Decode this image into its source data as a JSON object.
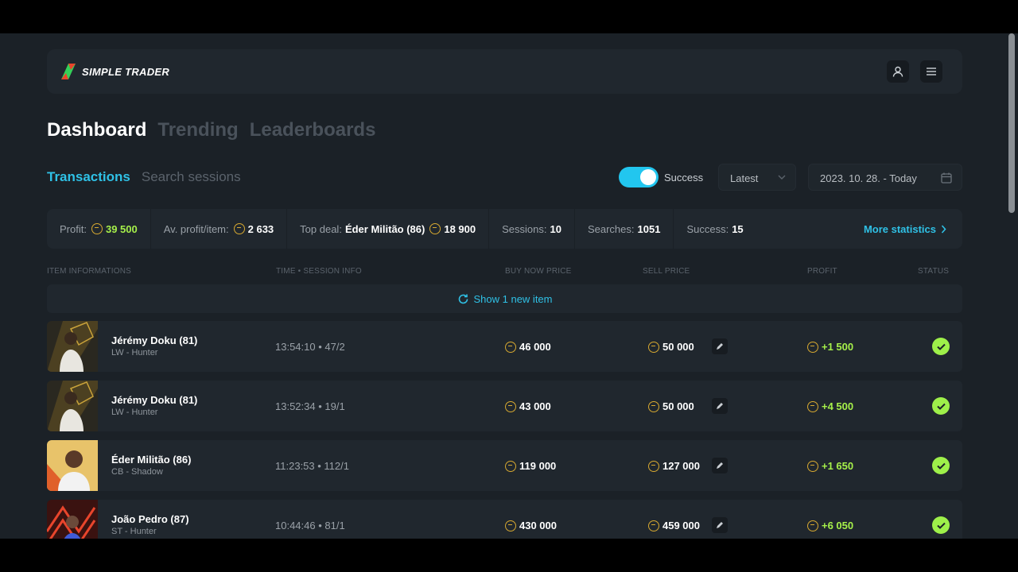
{
  "brand": {
    "name": "SIMPLE TRADER"
  },
  "nav": {
    "tabs": [
      {
        "label": "Dashboard"
      },
      {
        "label": "Trending"
      },
      {
        "label": "Leaderboards"
      }
    ]
  },
  "subnav": {
    "tabs": [
      {
        "label": "Transactions"
      },
      {
        "label": "Search sessions"
      }
    ]
  },
  "filters": {
    "toggle_label": "Success",
    "toggle_on": true,
    "sort_value": "Latest",
    "date_range": "2023. 10. 28. - Today"
  },
  "stats": {
    "profit_label": "Profit:",
    "profit_value": "39 500",
    "avg_label": "Av. profit/item:",
    "avg_value": "2 633",
    "top_label": "Top deal:",
    "top_name": "Éder Militão (86)",
    "top_value": "18 900",
    "sessions_label": "Sessions:",
    "sessions_value": "10",
    "searches_label": "Searches:",
    "searches_value": "1051",
    "success_label": "Success:",
    "success_value": "15",
    "more_label": "More statistics"
  },
  "table": {
    "headers": {
      "item": "ITEM INFORMATIONS",
      "time": "TIME • SESSION INFO",
      "buy": "BUY NOW PRICE",
      "sell": "SELL PRICE",
      "profit": "PROFIT",
      "status": "STATUS"
    },
    "new_items_label": "Show 1 new item",
    "rows": [
      {
        "name": "Jérémy Doku (81)",
        "sub": "LW - Hunter",
        "time": "13:54:10 • 47/2",
        "buy": "46 000",
        "sell": "50 000",
        "profit": "+1 500"
      },
      {
        "name": "Jérémy Doku (81)",
        "sub": "LW - Hunter",
        "time": "13:52:34 • 19/1",
        "buy": "43 000",
        "sell": "50 000",
        "profit": "+4 500"
      },
      {
        "name": "Éder Militão (86)",
        "sub": "CB - Shadow",
        "time": "11:23:53 • 112/1",
        "buy": "119 000",
        "sell": "127 000",
        "profit": "+1 650"
      },
      {
        "name": "João Pedro (87)",
        "sub": "ST - Hunter",
        "time": "10:44:46 • 81/1",
        "buy": "430 000",
        "sell": "459 000",
        "profit": "+6 050"
      }
    ]
  },
  "colors": {
    "accent": "#2fc1e6",
    "profit": "#a6f04a",
    "coin": "#d7a930",
    "status_ok": "#9ef04a"
  }
}
